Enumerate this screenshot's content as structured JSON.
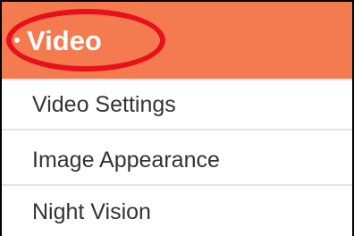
{
  "menu": {
    "header": {
      "label": "Video",
      "color": "#f47a4f"
    },
    "highlight_color": "#e8101a",
    "items": [
      {
        "label": "Video Settings"
      },
      {
        "label": "Image Appearance"
      },
      {
        "label": "Night Vision"
      }
    ]
  }
}
